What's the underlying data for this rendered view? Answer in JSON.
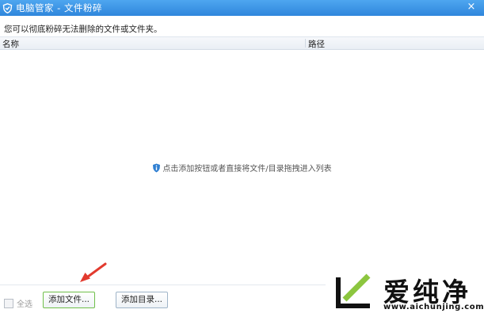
{
  "window": {
    "title": "电脑管家 - 文件粉碎",
    "close_glyph": "×"
  },
  "description": "您可以彻底粉碎无法删除的文件或文件夹。",
  "list": {
    "columns": [
      "名称",
      "路径"
    ],
    "empty_hint": "点击添加按钮或者直接将文件/目录拖拽进入列表"
  },
  "footer": {
    "select_all_label": "全选",
    "select_all_checked": false,
    "add_file_label": "添加文件...",
    "add_dir_label": "添加目录..."
  },
  "watermark": {
    "name": "爱纯净",
    "url": "www.aichunjing.com"
  },
  "colors": {
    "titlebar": "#3a93e4",
    "arrow": "#e23a2e",
    "add_file_border": "#6fbf4a",
    "logo_green": "#8cc63f"
  }
}
